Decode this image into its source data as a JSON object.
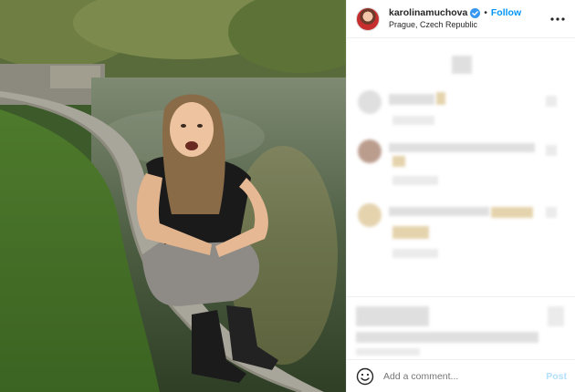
{
  "header": {
    "username": "karolinamuchova",
    "separator": "•",
    "follow_label": "Follow",
    "location": "Prague, Czech Republic",
    "verified_color": "#3897f0"
  },
  "composer": {
    "placeholder": "Add a comment...",
    "post_label": "Post"
  },
  "colors": {
    "follow": "#0095f6",
    "post_disabled": "#b2dffc",
    "border": "#efefef"
  },
  "icons": {
    "verified": "verified-badge-icon",
    "more": "more-options-icon",
    "emoji": "emoji-smiley-icon"
  }
}
